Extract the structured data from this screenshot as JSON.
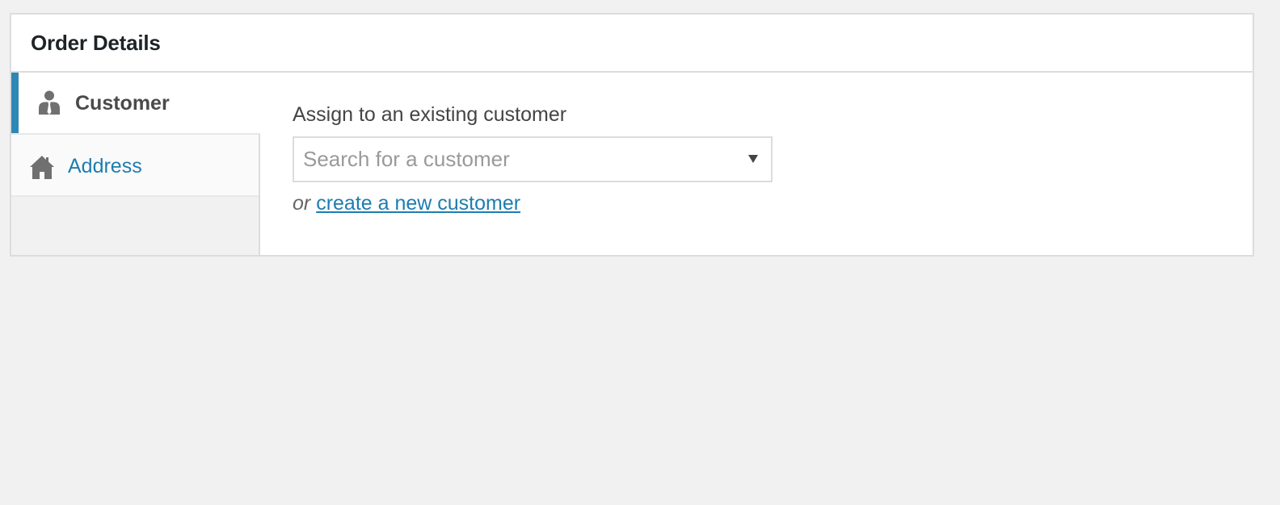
{
  "panel": {
    "title": "Order Details"
  },
  "tabs": [
    {
      "label": "Customer",
      "icon": "user-icon",
      "active": true
    },
    {
      "label": "Address",
      "icon": "home-icon",
      "active": false
    }
  ],
  "customer": {
    "assign_label": "Assign to an existing customer",
    "search_placeholder": "Search for a customer",
    "or_text": "or",
    "create_link": "create a new customer"
  },
  "colors": {
    "accent": "#2f87b6",
    "link": "#1d7db0",
    "border": "#dcdcde",
    "background": "#f1f1f1"
  }
}
